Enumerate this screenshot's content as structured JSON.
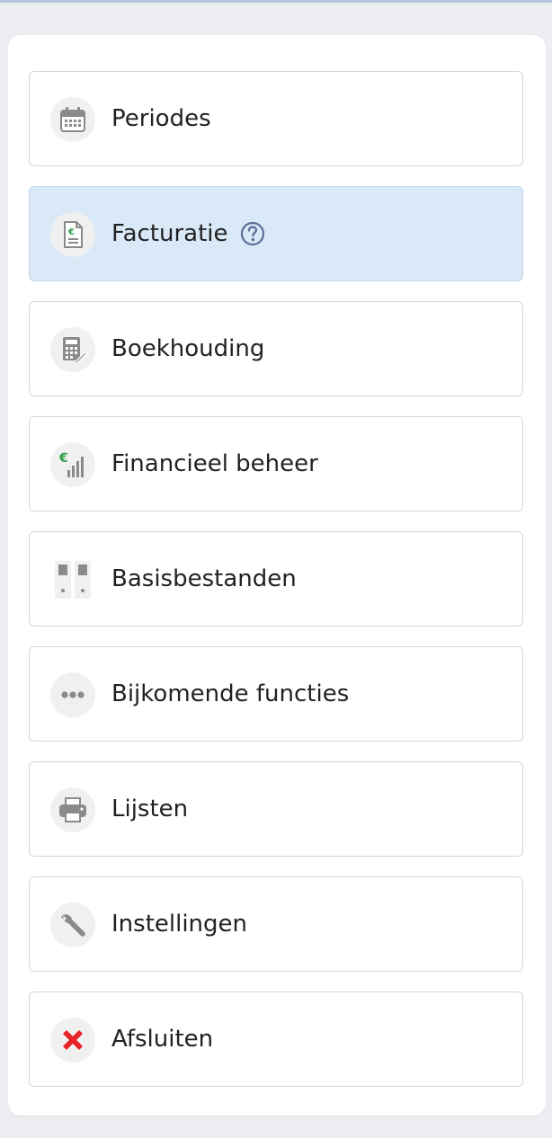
{
  "menu": {
    "items": [
      {
        "label": "Periodes",
        "icon": "calendar-icon"
      },
      {
        "label": "Facturatie",
        "icon": "invoice-euro-icon",
        "active": true,
        "help_icon": "help-circle-icon"
      },
      {
        "label": "Boekhouding",
        "icon": "calculator-icon"
      },
      {
        "label": "Financieel beheer",
        "icon": "euro-bars-icon"
      },
      {
        "label": "Basisbestanden",
        "icon": "binders-icon"
      },
      {
        "label": "Bijkomende functies",
        "icon": "more-dots-icon"
      },
      {
        "label": "Lijsten",
        "icon": "printer-icon"
      },
      {
        "label": "Instellingen",
        "icon": "wrench-icon"
      },
      {
        "label": "Afsluiten",
        "icon": "close-x-icon"
      }
    ]
  },
  "colors": {
    "page_bg": "#eceef2",
    "panel_bg": "#ffffff",
    "active_bg": "#d9e9f7",
    "border": "#d6d6d6",
    "euro_green": "#2e9e44",
    "exit_red": "#e8232a",
    "icon_gray": "#8a8a8a",
    "help_blue": "#5a6f9a"
  }
}
